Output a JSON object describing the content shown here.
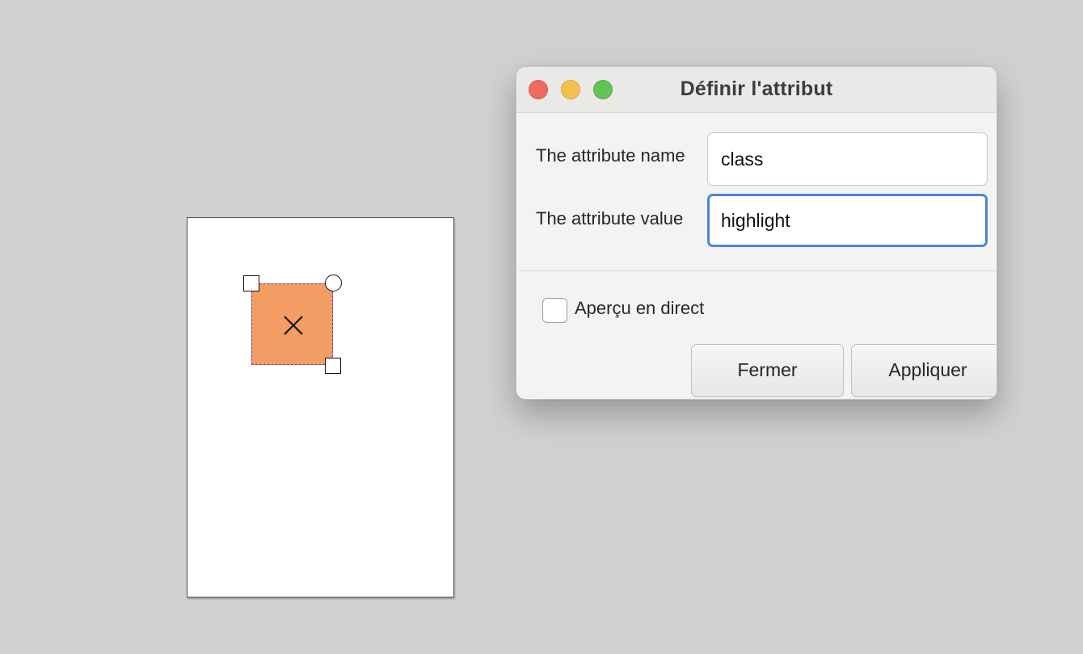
{
  "dialog": {
    "title": "Définir l'attribut",
    "attribute_name_label": "The attribute name",
    "attribute_name_value": "class",
    "attribute_value_label": "The attribute value",
    "attribute_value_value": "highlight",
    "live_preview_label": "Aperçu en direct",
    "live_preview_checked": false,
    "close_button_label": "Fermer",
    "apply_button_label": "Appliquer"
  },
  "window_controls": [
    "close-icon",
    "minimize-icon",
    "maximize-icon"
  ],
  "canvas": {
    "shape_fill": "#f39c63",
    "shape_outline": "#5b3fae",
    "page_background": "#ffffff"
  },
  "colors": {
    "focus_ring": "#4a86d8",
    "traffic_close": "#ee6a5e",
    "traffic_minimize": "#f5bf4f",
    "traffic_maximize": "#61c454"
  }
}
